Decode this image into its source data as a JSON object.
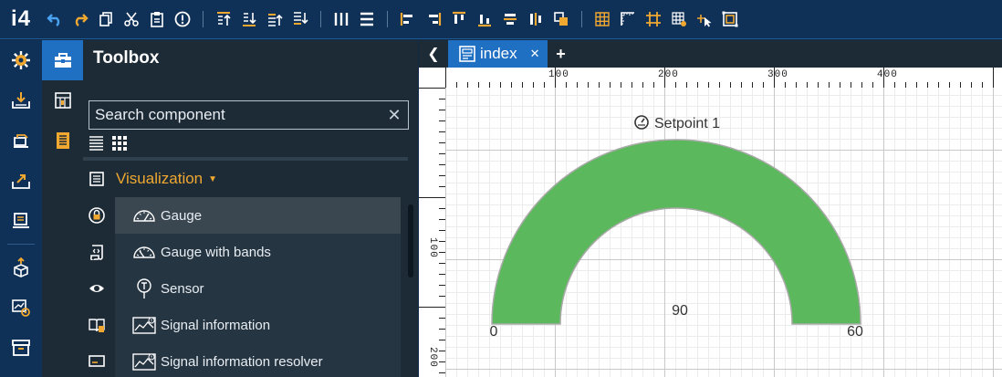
{
  "app": {
    "logo": "i4"
  },
  "toolbar": {
    "groups": [
      [
        "undo-icon",
        "redo-icon",
        "copy-icon",
        "cut-icon",
        "paste-icon",
        "info-icon"
      ],
      [
        "bring-front-icon",
        "send-back-icon",
        "bring-forward-icon",
        "send-backward-icon"
      ],
      [
        "distribute-horizontal-icon",
        "distribute-vertical-icon"
      ],
      [
        "align-left-icon",
        "align-right-icon",
        "align-top-icon",
        "align-bottom-icon",
        "align-center-horizontal-icon",
        "align-center-vertical-icon",
        "group-icon"
      ],
      [
        "grid-icon",
        "ruler-icon",
        "snap-icon",
        "grid-settings-icon",
        "pointer-icon",
        "resize-icon"
      ]
    ]
  },
  "toolbox": {
    "title": "Toolbox",
    "search_placeholder": "Search component",
    "section": "Visualization",
    "items": [
      {
        "label": "Gauge",
        "icon": "gauge-icon",
        "selected": true
      },
      {
        "label": "Gauge with bands",
        "icon": "gauge-bands-icon",
        "selected": false
      },
      {
        "label": "Sensor",
        "icon": "sensor-icon",
        "selected": false
      },
      {
        "label": "Signal information",
        "icon": "signal-info-icon",
        "selected": false
      },
      {
        "label": "Signal information resolver",
        "icon": "signal-resolver-icon",
        "selected": false
      }
    ]
  },
  "editor": {
    "tab_label": "index",
    "ruler_top_labels": [
      "100",
      "200",
      "300",
      "400"
    ],
    "ruler_left_labels": [
      "100",
      "200"
    ]
  },
  "gauge": {
    "title": "Setpoint 1",
    "value": "90",
    "min": "0",
    "max": "60",
    "color": "#5cb85c"
  },
  "colors": {
    "accent": "#1f6fc2",
    "section": "#f0a830",
    "toolbar_icon_blue": "#4aa3f0",
    "toolbar_icon_orange": "#f0a830"
  }
}
